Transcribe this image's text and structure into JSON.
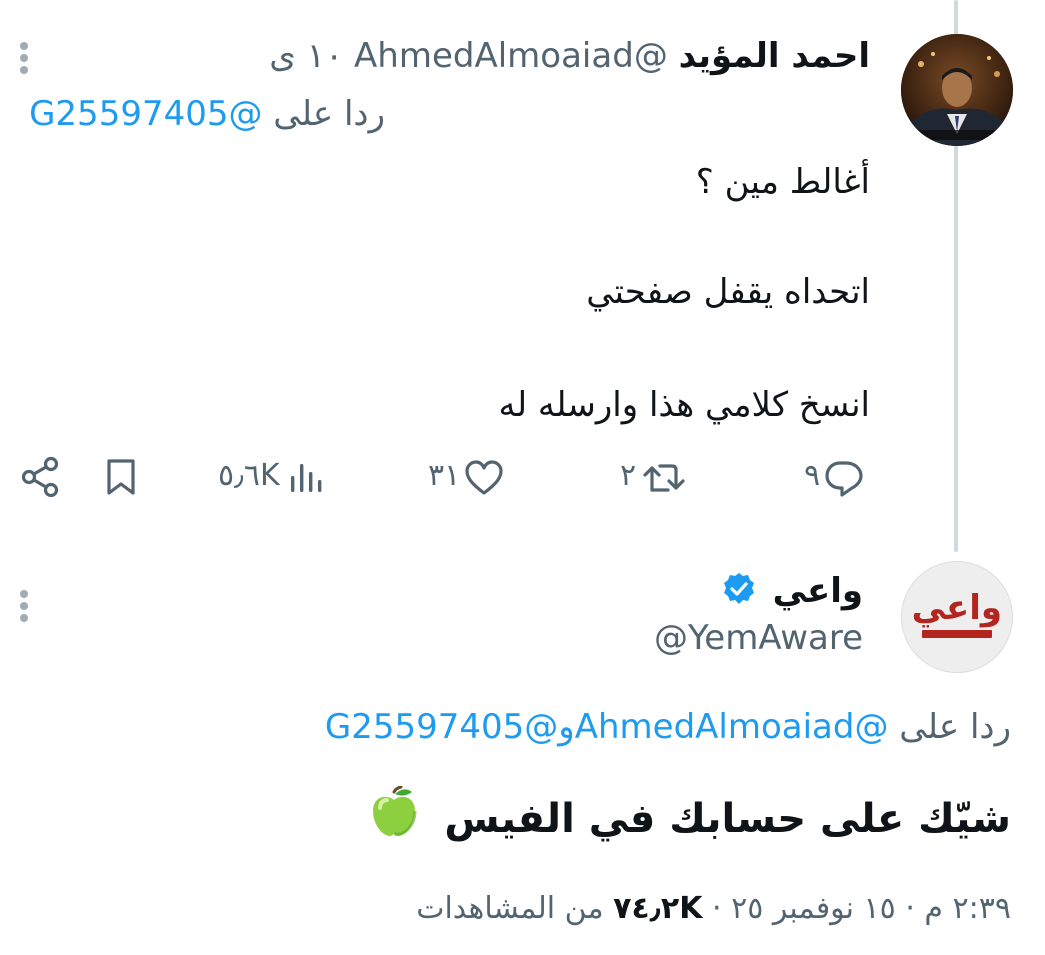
{
  "tweet1": {
    "author_name": "احمد المؤيد",
    "author_handle": "@AhmedAlmoaiad",
    "time": "١٠ ى",
    "reply_label": "ردا على",
    "reply_to": "@G25597405",
    "lines": [
      "أغالط مين ؟",
      "اتحداه يقفل صفحتي",
      "انسخ كلامي هذا وارسله له"
    ],
    "stats": {
      "replies": "٩",
      "retweets": "٢",
      "likes": "٣١",
      "views": "٥٫٦K"
    },
    "icons": [
      "reply-icon",
      "retweet-icon",
      "like-icon",
      "views-icon",
      "bookmark-icon",
      "share-icon",
      "more-icon"
    ]
  },
  "tweet2": {
    "author_name": "واعي",
    "author_handle": "@YemAware",
    "avatar_logo_text": "واعي",
    "reply_label": "ردا على",
    "reply_to_1": "@AhmedAlmoaiad",
    "reply_connector": "و",
    "reply_to_2": "@G25597405",
    "text": "شيّك على حسابك في الفيس",
    "emoji": "green-apple",
    "meta_time": "٢:٣٩ م",
    "meta_date": "١٥ نوفمبر ٢٥",
    "meta_views": "٧٤٫٢K",
    "meta_views_label": "من المشاهدات",
    "meta_separator": "·"
  },
  "colors": {
    "accent": "#1d9bf0",
    "text": "#0f1419",
    "muted": "#536471",
    "thread_line": "#cfd9de"
  }
}
